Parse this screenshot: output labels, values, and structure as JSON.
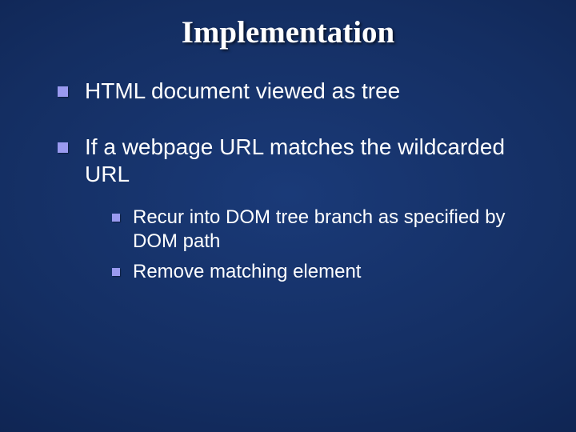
{
  "title": "Implementation",
  "bullets": [
    {
      "text": "HTML document viewed as tree"
    },
    {
      "text": "If a webpage URL matches the wildcarded URL",
      "sub": [
        {
          "text": "Recur into DOM tree branch as specified by DOM path"
        },
        {
          "text": "Remove matching element"
        }
      ]
    }
  ]
}
